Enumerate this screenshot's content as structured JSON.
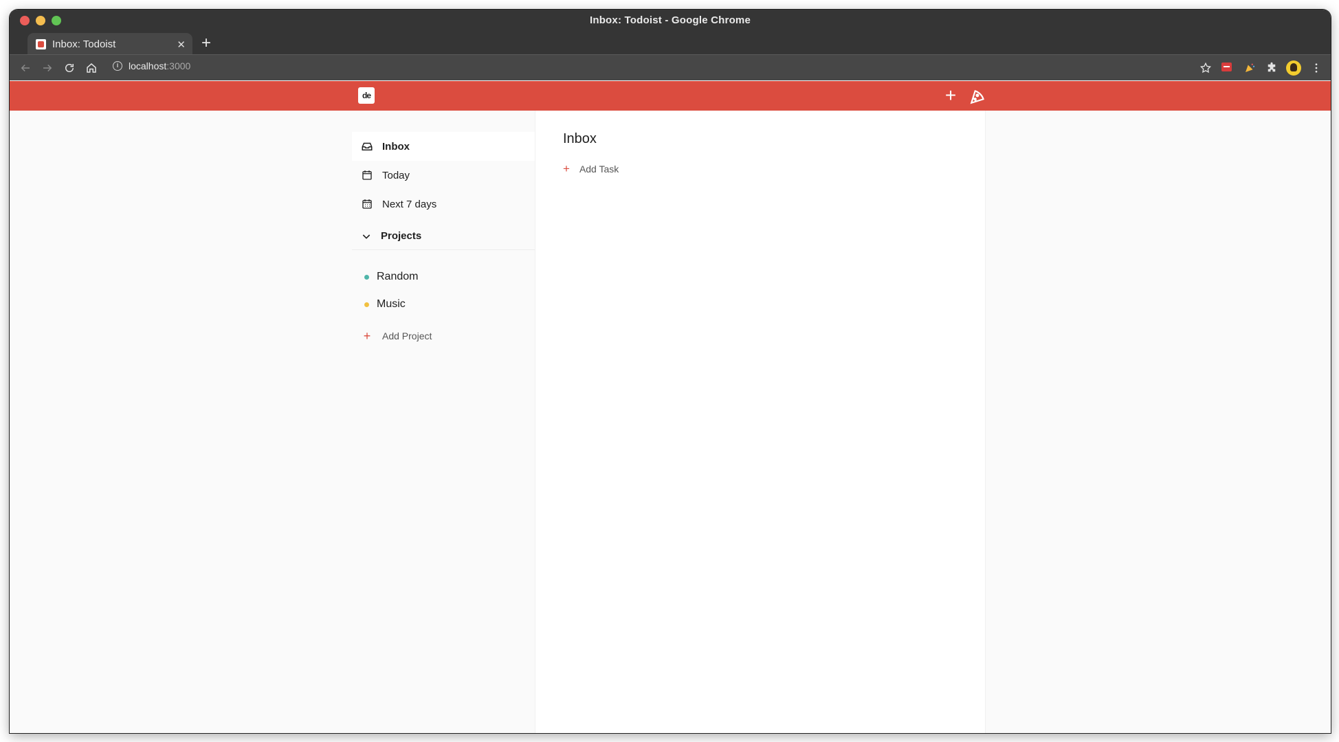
{
  "browser": {
    "window_title": "Inbox: Todoist - Google Chrome",
    "tab_title": "Inbox: Todoist",
    "tab_close": "✕",
    "new_tab": "+",
    "url_host": "localhost",
    "url_port": ":3000"
  },
  "header": {
    "logo_text": "de",
    "add_icon": "+",
    "brand_color": "#db4c3f"
  },
  "sidebar": {
    "items": [
      {
        "label": "Inbox",
        "icon": "inbox-icon"
      },
      {
        "label": "Today",
        "icon": "calendar-icon"
      },
      {
        "label": "Next 7 days",
        "icon": "calendar-week-icon"
      }
    ],
    "projects_label": "Projects",
    "projects": [
      {
        "label": "Random",
        "color": "#4fb5a9"
      },
      {
        "label": "Music",
        "color": "#f1c040"
      }
    ],
    "add_project_label": "Add Project",
    "add_symbol": "+"
  },
  "main": {
    "title": "Inbox",
    "add_task_label": "Add Task",
    "add_symbol": "+"
  }
}
